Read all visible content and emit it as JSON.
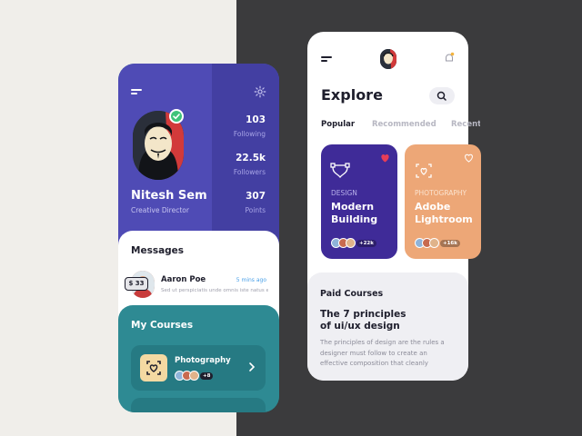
{
  "colors": {
    "profile_header": "#4f4bb5",
    "courses_bg": "#2e8a93",
    "design_card": "#3f2b98",
    "photo_card": "#eda777",
    "accent_red": "#e83d57",
    "online_green": "#3ec37a"
  },
  "profile": {
    "name": "Nitesh Sem",
    "role": "Creative Director",
    "stats": [
      {
        "value": "103",
        "label": "Following"
      },
      {
        "value": "22.5k",
        "label": "Followers"
      },
      {
        "value": "307",
        "label": "Points"
      }
    ]
  },
  "messages": {
    "title": "Messages",
    "items": [
      {
        "name": "Aaron Poe",
        "time": "5 mins ago",
        "text": "Sed ut perspiciatis unde omnis iste natus error"
      }
    ]
  },
  "my_courses": {
    "title": "My Courses",
    "items": [
      {
        "name": "Photography",
        "enrolled": "+8"
      }
    ]
  },
  "explore": {
    "title": "Explore",
    "tabs": [
      "Popular",
      "Recommended",
      "Recent"
    ],
    "cards": [
      {
        "category": "DESIGN",
        "title": "Modern Building",
        "enrolled": "+22k",
        "liked": true
      },
      {
        "category": "PHOTOGRAPHY",
        "title": "Adobe Lightroom",
        "enrolled": "+16k",
        "liked": false
      }
    ],
    "paid": {
      "title": "Paid Courses",
      "course": "The 7 principles of ui/ux design",
      "price": "$ 33",
      "description": "The principles of design are the rules a designer must follow to create an effective composition that cleanly"
    }
  }
}
